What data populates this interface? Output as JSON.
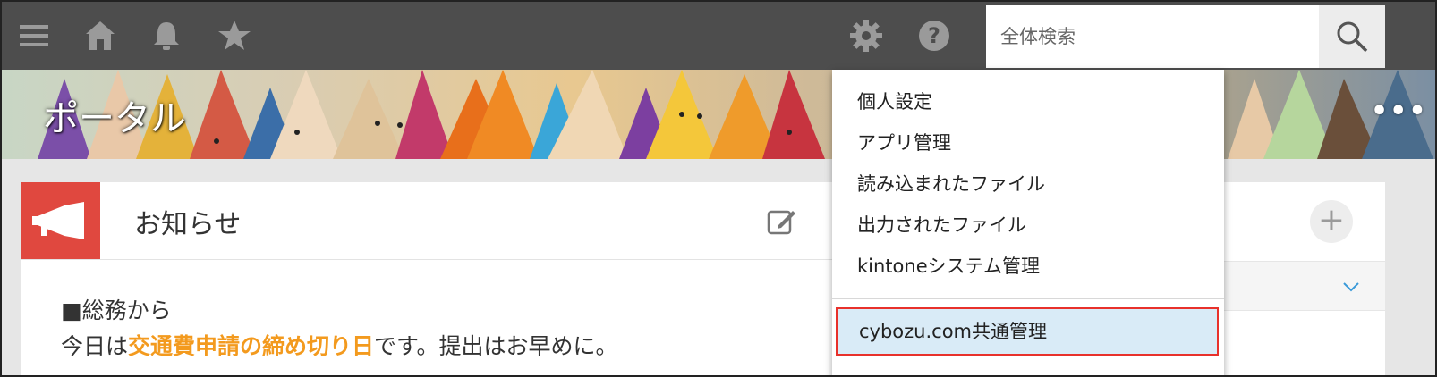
{
  "search": {
    "placeholder": "全体検索"
  },
  "portal": {
    "title": "ポータル"
  },
  "header_icons": [
    "menu-icon",
    "home-icon",
    "bell-icon",
    "star-icon",
    "gear-icon",
    "help-icon",
    "search-icon"
  ],
  "card": {
    "title": "お知らせ",
    "line1": "■総務から",
    "line2_prefix": "今日は",
    "line2_highlight": "交通費申請の締め切り日",
    "line2_suffix": "です。提出はお早めに。"
  },
  "menu": {
    "items": [
      "個人設定",
      "アプリ管理",
      "読み込まれたファイル",
      "出力されたファイル",
      "kintoneシステム管理"
    ],
    "selected": "cybozu.com共通管理"
  },
  "colors": {
    "topbar": "#4d4d4d",
    "notice_icon_bg": "#e0483f",
    "highlight_text": "#f39a1e",
    "selected_bg": "#d9ebf7",
    "selected_border": "#e8312b"
  }
}
